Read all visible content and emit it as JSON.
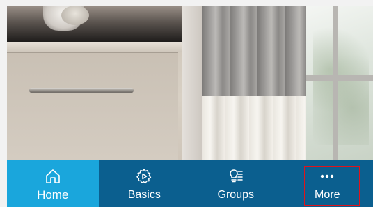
{
  "nav": {
    "items": [
      {
        "label": "Home",
        "icon": "home-icon",
        "active": true
      },
      {
        "label": "Basics",
        "icon": "gear-play-icon",
        "active": false
      },
      {
        "label": "Groups",
        "icon": "lightbulb-list-icon",
        "active": false
      },
      {
        "label": "More",
        "icon": "more-dots-icon",
        "active": false,
        "highlighted": true
      }
    ]
  },
  "colors": {
    "nav_background": "#0b5f8f",
    "nav_active": "#1aa6dc",
    "highlight": "#e0141b",
    "text": "#ffffff"
  }
}
